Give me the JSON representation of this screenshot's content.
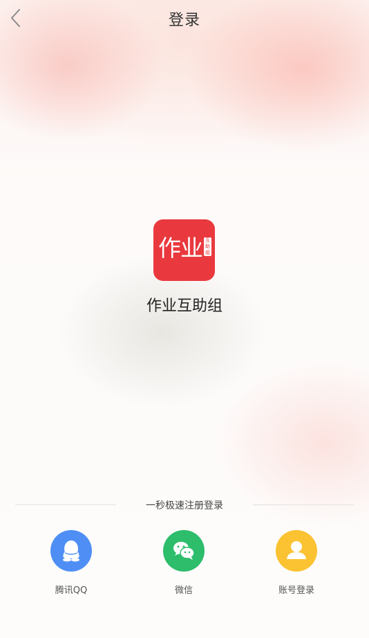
{
  "header": {
    "title": "登录",
    "back_icon": "chevron-left-icon"
  },
  "app": {
    "icon_text": "作业",
    "icon_badge": "互助组",
    "name": "作业互助组",
    "icon_color": "#e9393e"
  },
  "signup": {
    "divider_text": "一秒极速注册登录"
  },
  "login_options": [
    {
      "label": "腾讯QQ",
      "icon": "qq-icon",
      "color": "#4f8ff5"
    },
    {
      "label": "微信",
      "icon": "wechat-icon",
      "color": "#2dbd6b"
    },
    {
      "label": "账号登录",
      "icon": "user-icon",
      "color": "#fbc232"
    }
  ]
}
